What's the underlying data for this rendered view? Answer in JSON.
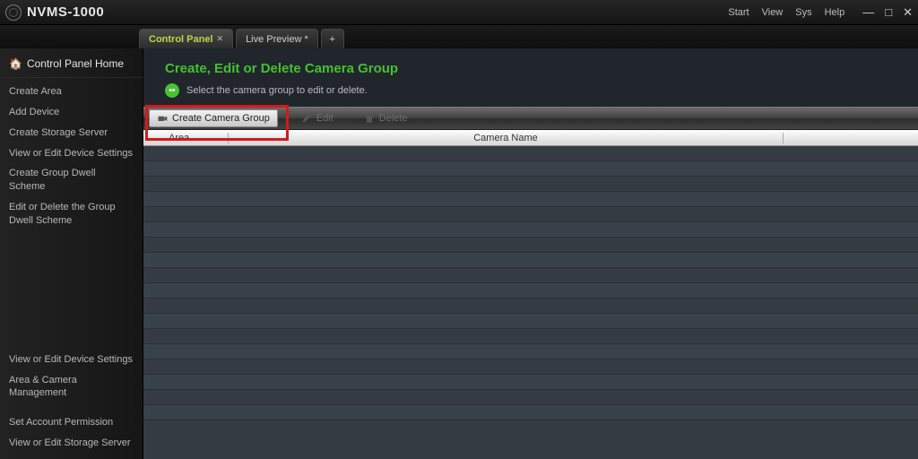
{
  "app": {
    "title": "NVMS-1000"
  },
  "menu": {
    "start": "Start",
    "view": "View",
    "sys": "Sys",
    "help": "Help"
  },
  "tabs": {
    "control_panel": "Control Panel",
    "live_preview": "Live Preview *"
  },
  "sidebar": {
    "home": "Control Panel Home",
    "items": [
      "Create Area",
      "Add Device",
      "Create Storage Server",
      "View or Edit Device Settings",
      "Create Group Dwell Scheme",
      "Edit or Delete the Group Dwell Scheme"
    ],
    "bottom": [
      "View or Edit Device Settings",
      "Area & Camera Management",
      "Set Account Permission",
      "View or Edit Storage Server"
    ]
  },
  "header": {
    "title": "Create, Edit or Delete Camera Group",
    "hint": "Select the camera group to edit or delete."
  },
  "toolbar": {
    "create": "Create Camera Group",
    "edit": "Edit",
    "delete": "Delete"
  },
  "columns": {
    "area": "Area",
    "camera_name": "Camera Name"
  }
}
